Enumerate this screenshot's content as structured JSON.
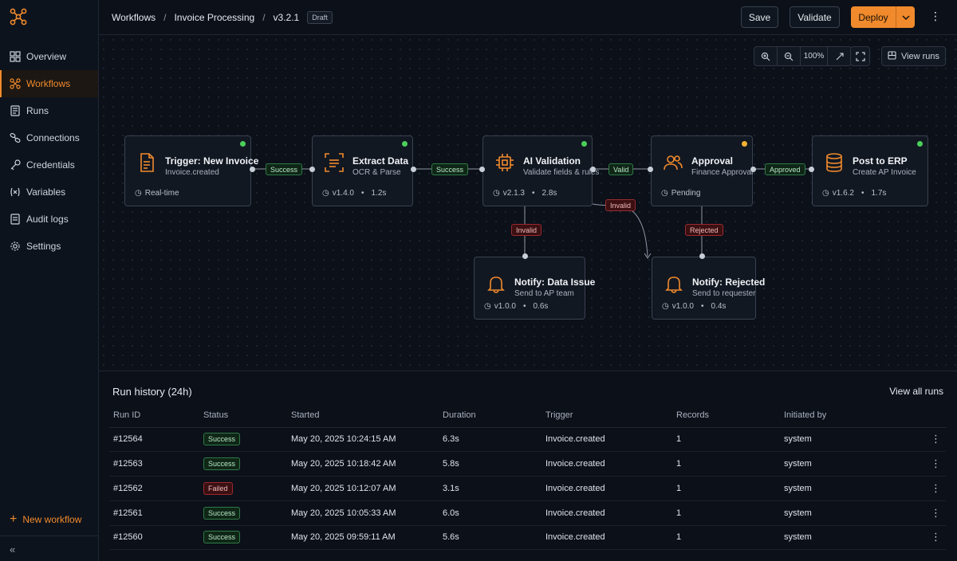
{
  "sidebar": {
    "items": [
      {
        "label": "Overview",
        "icon": "dashboard-icon"
      },
      {
        "label": "Workflows",
        "icon": "workflow-icon",
        "active": true
      },
      {
        "label": "Runs",
        "icon": "runs-icon"
      },
      {
        "label": "Connections",
        "icon": "link-icon"
      },
      {
        "label": "Credentials",
        "icon": "key-icon"
      },
      {
        "label": "Variables",
        "icon": "variables-icon"
      },
      {
        "label": "Audit logs",
        "icon": "audit-log-icon"
      },
      {
        "label": "Settings",
        "icon": "gear-icon"
      }
    ],
    "new_workflow": "New workflow",
    "collapse_icon": "«"
  },
  "header": {
    "breadcrumbs": [
      "Workflows",
      "Invoice Processing",
      "v3.2.1"
    ],
    "separator": "/",
    "draft_badge": "Draft",
    "save_label": "Save",
    "validate_label": "Validate",
    "deploy_label": "Deploy",
    "more_icon": "⋮"
  },
  "canvas": {
    "zoom": "100%",
    "view_runs": "View runs",
    "nodes": {
      "trigger": {
        "title": "Trigger: New Invoice",
        "subtitle": "Invoice.created",
        "meta": "Real-time",
        "status_color": "#4ccf5a"
      },
      "extract": {
        "title": "Extract Data",
        "subtitle": "OCR & Parse",
        "version": "v1.4.0",
        "duration": "1.2s",
        "status_color": "#4ccf5a"
      },
      "ai": {
        "title": "AI Validation",
        "subtitle": "Validate fields & rules",
        "version": "v2.1.3",
        "duration": "2.8s",
        "status_color": "#4ccf5a"
      },
      "approval": {
        "title": "Approval",
        "subtitle": "Finance Approval",
        "meta": "Pending",
        "status_color": "#f2b233"
      },
      "erp": {
        "title": "Post to ERP",
        "subtitle": "Create AP Invoice",
        "version": "v1.6.2",
        "duration": "1.7s",
        "status_color": "#4ccf5a"
      },
      "notify_issue": {
        "title": "Notify: Data Issue",
        "subtitle": "Send to AP team",
        "version": "v1.0.0",
        "duration": "0.6s"
      },
      "notify_rejected": {
        "title": "Notify: Rejected",
        "subtitle": "Send to requester",
        "version": "v1.0.0",
        "duration": "0.4s"
      }
    },
    "edge_labels": {
      "e1": "Success",
      "e2": "Success",
      "e3": "Valid",
      "e4": "Approved",
      "e5": "Invalid",
      "e6": "Invalid",
      "e7": "Rejected"
    },
    "meta_separator": "•"
  },
  "runs": {
    "title": "Run history (24h)",
    "view_all": "View all runs",
    "columns": [
      "Run ID",
      "Status",
      "Started",
      "Duration",
      "Trigger",
      "Records",
      "Initiated by"
    ],
    "rows": [
      {
        "id": "#12564",
        "status": "Success",
        "started": "May 20, 2025 10:24:15 AM",
        "duration": "6.3s",
        "trigger": "Invoice.created",
        "records": "1",
        "by": "system"
      },
      {
        "id": "#12563",
        "status": "Success",
        "started": "May 20, 2025 10:18:42 AM",
        "duration": "5.8s",
        "trigger": "Invoice.created",
        "records": "1",
        "by": "system"
      },
      {
        "id": "#12562",
        "status": "Failed",
        "started": "May 20, 2025 10:12:07 AM",
        "duration": "3.1s",
        "trigger": "Invoice.created",
        "records": "1",
        "by": "system"
      },
      {
        "id": "#12561",
        "status": "Success",
        "started": "May 20, 2025 10:05:33 AM",
        "duration": "6.0s",
        "trigger": "Invoice.created",
        "records": "1",
        "by": "system"
      },
      {
        "id": "#12560",
        "status": "Success",
        "started": "May 20, 2025 09:59:11 AM",
        "duration": "5.6s",
        "trigger": "Invoice.created",
        "records": "1",
        "by": "system"
      }
    ],
    "row_menu_icon": "⋮"
  },
  "colors": {
    "accent": "#f08a2c",
    "success": "#4ccf5a",
    "pending": "#f2b233",
    "danger": "#9a2a2f"
  }
}
